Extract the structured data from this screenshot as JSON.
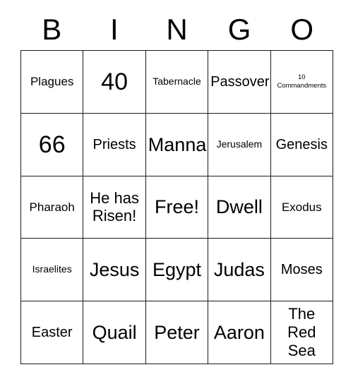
{
  "card": {
    "title": "BINGO",
    "header": [
      "B",
      "I",
      "N",
      "G",
      "O"
    ],
    "border_color": "#1a1a1a",
    "background_color": "#ffffff",
    "text_color": "#000000",
    "columns": 5,
    "rows": 5,
    "cells": [
      [
        {
          "text": "Plagues",
          "size": "s"
        },
        {
          "text": "40",
          "size": "xxl"
        },
        {
          "text": "Tabernacle",
          "size": "xs"
        },
        {
          "text": "Passover",
          "size": "m"
        },
        {
          "text": "10\nCommandments",
          "size": "xxs"
        }
      ],
      [
        {
          "text": "66",
          "size": "xxl"
        },
        {
          "text": "Priests",
          "size": "m"
        },
        {
          "text": "Manna",
          "size": "xl"
        },
        {
          "text": "Jerusalem",
          "size": "xs"
        },
        {
          "text": "Genesis",
          "size": "m"
        }
      ],
      [
        {
          "text": "Pharaoh",
          "size": "s"
        },
        {
          "text": "He has\nRisen!",
          "size": "l"
        },
        {
          "text": "Free!",
          "size": "xl"
        },
        {
          "text": "Dwell",
          "size": "xl"
        },
        {
          "text": "Exodus",
          "size": "s"
        }
      ],
      [
        {
          "text": "Israelites",
          "size": "xs"
        },
        {
          "text": "Jesus",
          "size": "xl"
        },
        {
          "text": "Egypt",
          "size": "xl"
        },
        {
          "text": "Judas",
          "size": "xl"
        },
        {
          "text": "Moses",
          "size": "m"
        }
      ],
      [
        {
          "text": "Easter",
          "size": "m"
        },
        {
          "text": "Quail",
          "size": "xl"
        },
        {
          "text": "Peter",
          "size": "xl"
        },
        {
          "text": "Aaron",
          "size": "xl"
        },
        {
          "text": "The\nRed\nSea",
          "size": "l"
        }
      ]
    ]
  }
}
